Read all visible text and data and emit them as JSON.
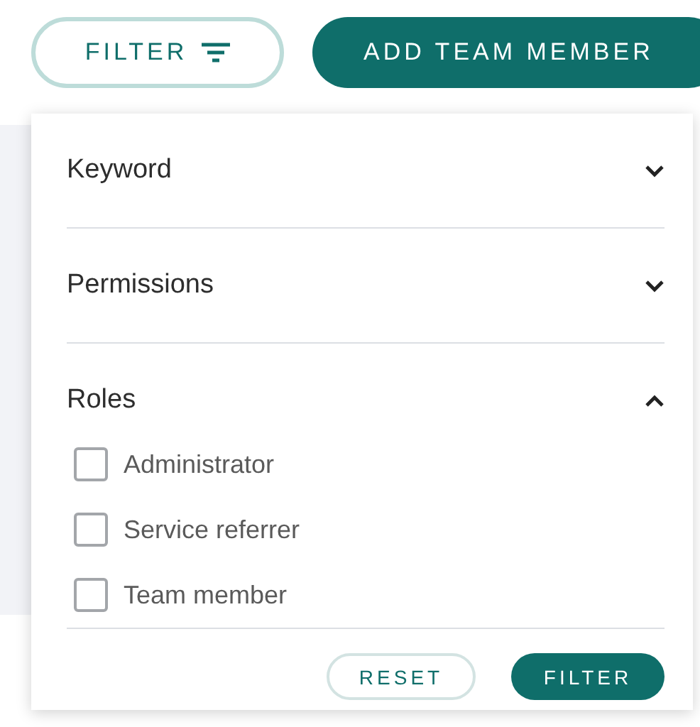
{
  "toolbar": {
    "filter_button": {
      "label": "FILTER"
    },
    "add_button": {
      "label": "ADD TEAM MEMBER"
    }
  },
  "filter_panel": {
    "sections": [
      {
        "label": "Keyword",
        "expanded": false
      },
      {
        "label": "Permissions",
        "expanded": false
      },
      {
        "label": "Roles",
        "expanded": true,
        "options": [
          {
            "label": "Administrator",
            "checked": false
          },
          {
            "label": "Service referrer",
            "checked": false
          },
          {
            "label": "Team member",
            "checked": false
          }
        ]
      }
    ],
    "buttons": [
      {
        "label": "RESET",
        "kind": "secondary"
      },
      {
        "label": "FILTER",
        "kind": "primary"
      }
    ]
  }
}
